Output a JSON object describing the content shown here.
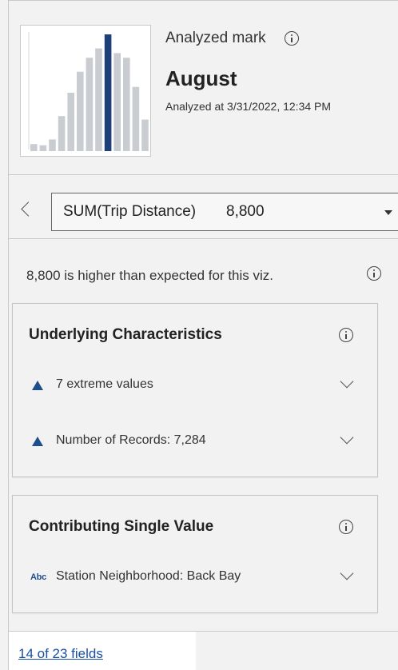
{
  "header": {
    "analyzed_label": "Analyzed mark",
    "mark_title": "August",
    "analyzed_time": "Analyzed at 3/31/2022, 12:34 PM"
  },
  "thumbnail": {
    "bars": [
      0.06,
      0.05,
      0.1,
      0.3,
      0.5,
      0.68,
      0.8,
      0.88,
      1.0,
      0.84,
      0.8,
      0.55,
      0.27
    ],
    "highlight_index": 8,
    "bar_color": "#c9ccd1",
    "highlight_color": "#1f3f78"
  },
  "selector": {
    "field_name": "SUM(Trip Distance)",
    "field_value": "8,800"
  },
  "summary_text": "8,800 is higher than expected for this viz.",
  "underlying": {
    "title": "Underlying Characteristics",
    "items": [
      {
        "icon": "triangle-up-icon",
        "label": "7 extreme values"
      },
      {
        "icon": "triangle-up-icon",
        "label": "Number of Records: 7,284"
      }
    ]
  },
  "contributing": {
    "title": "Contributing Single Value",
    "items": [
      {
        "icon": "abc-icon",
        "icon_text": "Abc",
        "label": "Station Neighborhood: Back Bay"
      }
    ]
  },
  "footer": {
    "fields_link": "14 of 23 fields"
  },
  "colors": {
    "accent": "#1f4e8c",
    "link": "#1a4fa6",
    "panel_bg": "#f2f2f2"
  }
}
